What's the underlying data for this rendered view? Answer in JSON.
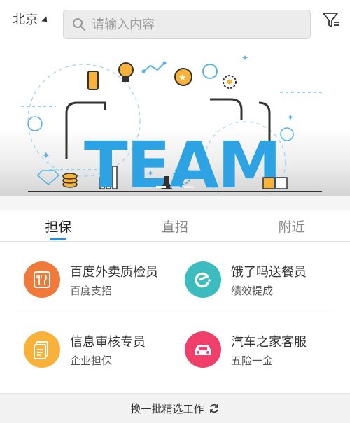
{
  "header": {
    "city": "北京",
    "search_placeholder": "请输入内容"
  },
  "banner": {
    "word": "TEAM",
    "slide_count": 3,
    "active_slide": 1
  },
  "tabs": [
    {
      "label": "担保",
      "active": true
    },
    {
      "label": "直招",
      "active": false
    },
    {
      "label": "附近",
      "active": false
    }
  ],
  "jobs": [
    {
      "title": "百度外卖质检员",
      "subtitle": "百度支招",
      "icon": "fork-knife-icon",
      "color": "#f07a3a"
    },
    {
      "title": "饿了吗送餐员",
      "subtitle": "绩效提成",
      "icon": "eleme-logo-icon",
      "color": "#3cbcbf"
    },
    {
      "title": "信息审核专员",
      "subtitle": "企业担保",
      "icon": "document-icon",
      "color": "#f8b23a"
    },
    {
      "title": "汽车之家客服",
      "subtitle": "五险一金",
      "icon": "car-icon",
      "color": "#ef3f6a"
    }
  ],
  "footer": {
    "refresh_label": "换一批精选工作"
  }
}
